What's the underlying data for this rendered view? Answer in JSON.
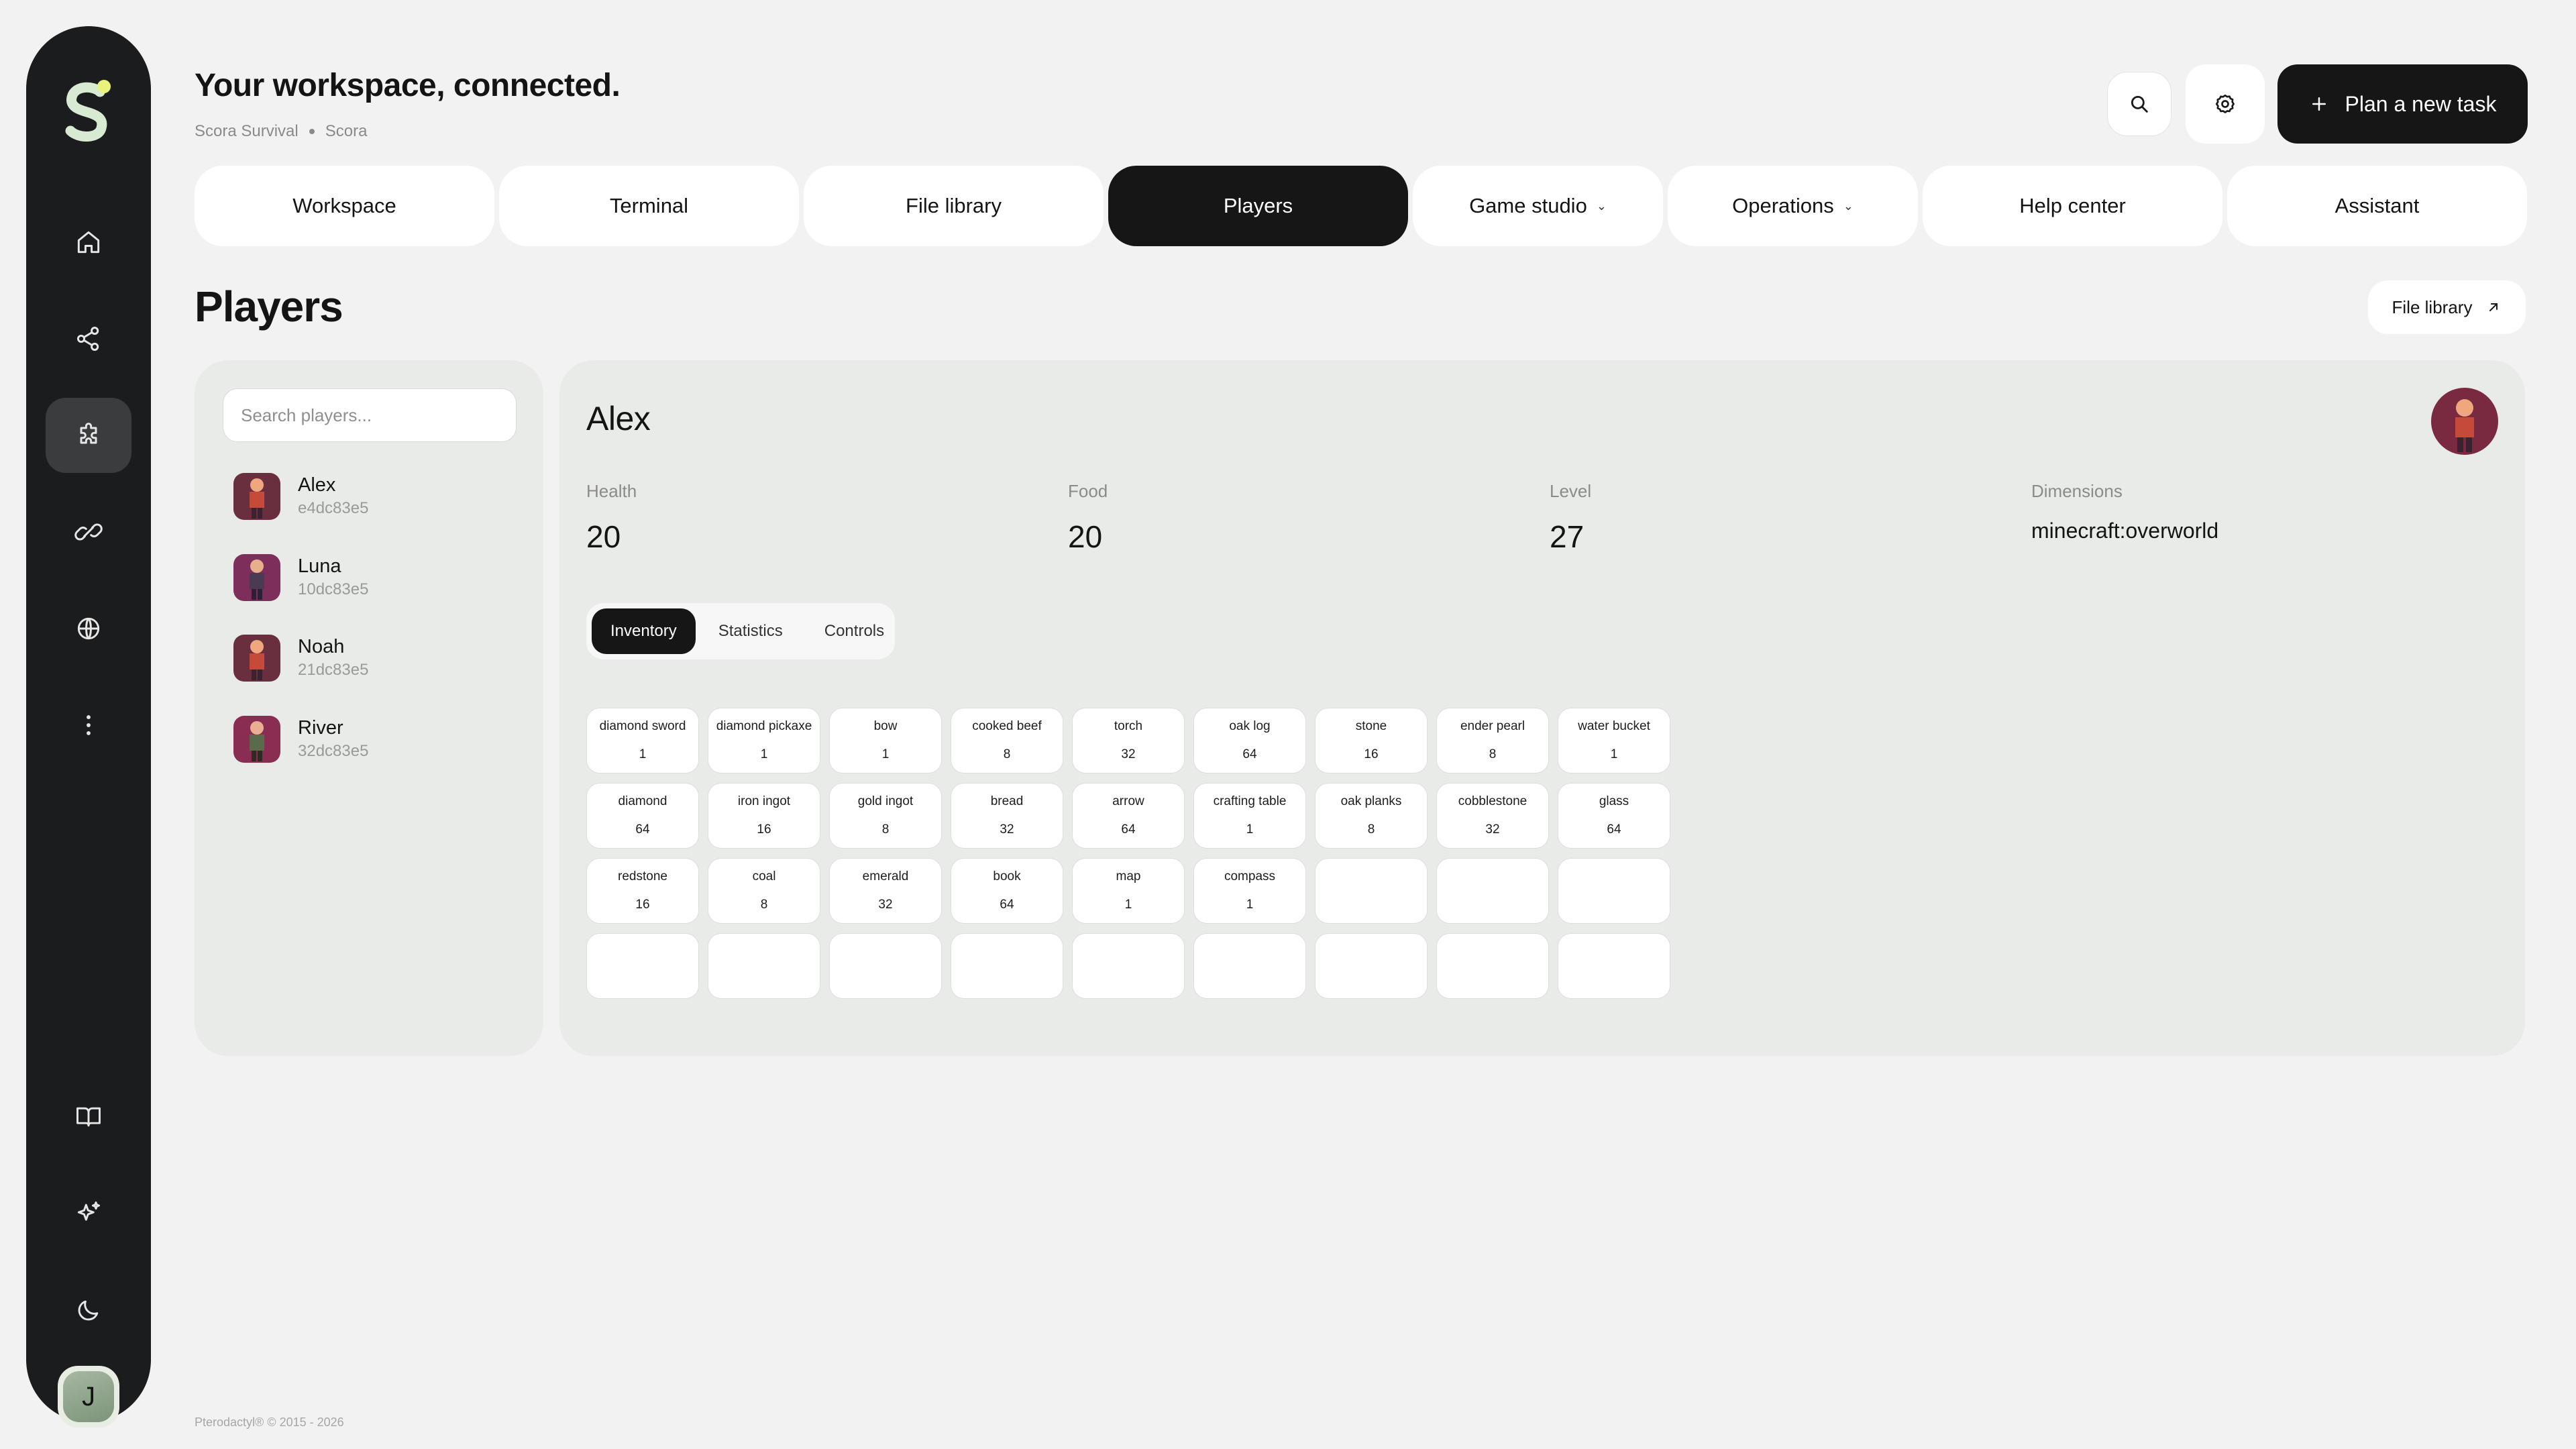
{
  "header": {
    "title": "Your workspace, connected.",
    "breadcrumb": [
      "Scora Survival",
      "Scora"
    ],
    "plan_button": "Plan a new task"
  },
  "sidebar": {
    "items": [
      {
        "icon": "home-icon"
      },
      {
        "icon": "share-icon"
      },
      {
        "icon": "puzzle-icon",
        "active": true
      },
      {
        "icon": "link-icon"
      },
      {
        "icon": "globe-icon"
      },
      {
        "icon": "more-vertical-icon"
      },
      {
        "icon": "book-icon"
      },
      {
        "icon": "sparkles-icon"
      },
      {
        "icon": "moon-icon"
      }
    ],
    "user_initial": "J"
  },
  "tabs": [
    {
      "label": "Workspace"
    },
    {
      "label": "Terminal"
    },
    {
      "label": "File library"
    },
    {
      "label": "Players",
      "active": true
    },
    {
      "label": "Game studio",
      "dropdown": true
    },
    {
      "label": "Operations",
      "dropdown": true
    },
    {
      "label": "Help center"
    },
    {
      "label": "Assistant"
    }
  ],
  "section": {
    "title": "Players",
    "file_library_link": "File library"
  },
  "player_list": {
    "search_placeholder": "Search players...",
    "players": [
      {
        "name": "Alex",
        "id": "e4dc83e5"
      },
      {
        "name": "Luna",
        "id": "10dc83e5"
      },
      {
        "name": "Noah",
        "id": "21dc83e5"
      },
      {
        "name": "River",
        "id": "32dc83e5"
      }
    ]
  },
  "detail": {
    "name": "Alex",
    "stats": [
      {
        "label": "Health",
        "value": "20"
      },
      {
        "label": "Food",
        "value": "20"
      },
      {
        "label": "Level",
        "value": "27"
      },
      {
        "label": "Dimensions",
        "value": "minecraft:overworld"
      }
    ],
    "subtabs": [
      {
        "label": "Inventory",
        "active": true
      },
      {
        "label": "Statistics"
      },
      {
        "label": "Controls"
      }
    ],
    "inventory": [
      {
        "name": "diamond sword",
        "count": "1"
      },
      {
        "name": "diamond pickaxe",
        "count": "1"
      },
      {
        "name": "bow",
        "count": "1"
      },
      {
        "name": "cooked beef",
        "count": "8"
      },
      {
        "name": "torch",
        "count": "32"
      },
      {
        "name": "oak log",
        "count": "64"
      },
      {
        "name": "stone",
        "count": "16"
      },
      {
        "name": "ender pearl",
        "count": "8"
      },
      {
        "name": "water bucket",
        "count": "1"
      },
      {
        "name": "diamond",
        "count": "64"
      },
      {
        "name": "iron ingot",
        "count": "16"
      },
      {
        "name": "gold ingot",
        "count": "8"
      },
      {
        "name": "bread",
        "count": "32"
      },
      {
        "name": "arrow",
        "count": "64"
      },
      {
        "name": "crafting table",
        "count": "1"
      },
      {
        "name": "oak planks",
        "count": "8"
      },
      {
        "name": "cobblestone",
        "count": "32"
      },
      {
        "name": "glass",
        "count": "64"
      },
      {
        "name": "redstone",
        "count": "16"
      },
      {
        "name": "coal",
        "count": "8"
      },
      {
        "name": "emerald",
        "count": "32"
      },
      {
        "name": "book",
        "count": "64"
      },
      {
        "name": "map",
        "count": "1"
      },
      {
        "name": "compass",
        "count": "1"
      },
      {
        "name": "",
        "count": ""
      },
      {
        "name": "",
        "count": ""
      },
      {
        "name": "",
        "count": ""
      },
      {
        "name": "",
        "count": ""
      },
      {
        "name": "",
        "count": ""
      },
      {
        "name": "",
        "count": ""
      },
      {
        "name": "",
        "count": ""
      },
      {
        "name": "",
        "count": ""
      },
      {
        "name": "",
        "count": ""
      },
      {
        "name": "",
        "count": ""
      },
      {
        "name": "",
        "count": ""
      },
      {
        "name": "",
        "count": ""
      }
    ]
  },
  "footer": {
    "copyright": "Pterodactyl® © 2015 - 2026"
  },
  "colors": {
    "dark": "#161616",
    "panel": "#e8ebe7",
    "background": "#f2f2f2",
    "logo_dot": "#e9f27a"
  }
}
